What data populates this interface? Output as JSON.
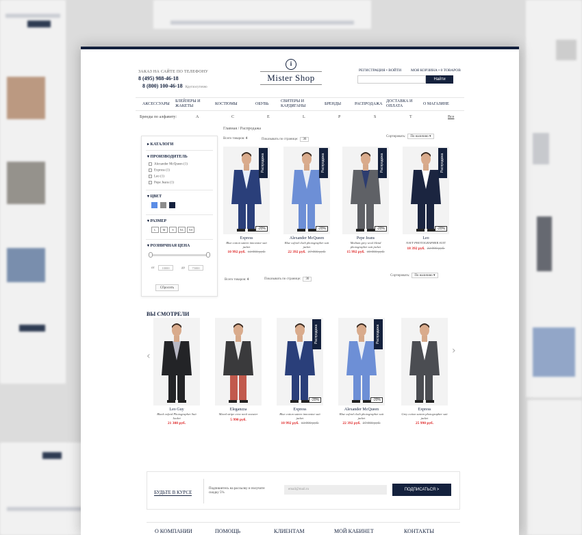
{
  "header": {
    "phone_caption": "Заказ на сайте по телефону",
    "phones": [
      "8 (495) 988-46-18",
      "8 (800) 100-46-18"
    ],
    "phone_note": "Круглосуточно",
    "logo_text": "Mister Shop",
    "logo_emblem": "i",
    "auth_link": "Регистрация • Войти",
    "cart_link": "Моя корзина • 0 товаров",
    "search_placeholder": "",
    "search_button": "Найти"
  },
  "nav": [
    {
      "label": "Аксессуары"
    },
    {
      "label": "Блейзеры и жакеты"
    },
    {
      "label": "Костюмы"
    },
    {
      "label": "Обувь"
    },
    {
      "label": "Свитеры и кардиганы"
    },
    {
      "label": "Бренды"
    },
    {
      "label": "Распродажа"
    },
    {
      "label": "Доставка и оплата"
    },
    {
      "label": "О магазине"
    }
  ],
  "brands_row": {
    "label": "Бренды по алфавиту:",
    "letters": [
      "A",
      "C",
      "E",
      "L",
      "P",
      "S",
      "T"
    ],
    "all": "Все"
  },
  "breadcrumb": "Главная / Распродажа",
  "sidebar": {
    "catalog": "Каталоги",
    "manufacturer": "Производитель",
    "manufacturers": [
      "Alexander McQueen (1)",
      "Express (1)",
      "Leo (1)",
      "Pepe Jeans (1)"
    ],
    "color": "Цвет",
    "colors": [
      "#5b8de6",
      "#8d8d8d",
      "#14213d"
    ],
    "size": "Размер",
    "sizes": [
      "L",
      "M",
      "S",
      "XL",
      "XS"
    ],
    "price": "Розничная цена",
    "price_from_label": "от",
    "price_from": "10000",
    "price_to_label": "до",
    "price_to": "75000",
    "reset": "Сбросить"
  },
  "toolbar": {
    "total_label": "Всего товаров:",
    "total": "4",
    "per_page_label": "Показывать по странице:",
    "per_page": "36",
    "sort_label": "Сортировать:",
    "sort_value": "По наличию"
  },
  "products": [
    {
      "name": "Express",
      "desc": "Blue cotton sateen innovator suit jacket",
      "price": "10 992 руб.",
      "old": "13 990 руб.",
      "discount": "-20%",
      "sale": "Распродажа",
      "jacket": "#2a3f7a",
      "shirt": "#e8eef8",
      "pants": "#2a3f7a"
    },
    {
      "name": "Alexander McQueen",
      "desc": "Blue oxford cloth photographer suit jacket",
      "price": "22 392 руб.",
      "old": "27 990 руб.",
      "discount": "-20%",
      "sale": "Распродажа",
      "jacket": "#6d8fd6",
      "shirt": "#e9edf5",
      "pants": "#6d8fd6"
    },
    {
      "name": "Pepe Jeans",
      "desc": "Medium grey wool blend photographer suit jacket",
      "price": "15 992 руб.",
      "old": "19 990 руб.",
      "discount": "-20%",
      "sale": "Распродажа",
      "jacket": "#5f6166",
      "shirt": "#2d3d6f",
      "pants": "#5f6166"
    },
    {
      "name": "Leo",
      "desc": "NAVY PHOTOGRAPHER SUIT",
      "price": "18 392 руб.",
      "old": "22 990 руб.",
      "discount": "-20%",
      "sale": "Распродажа",
      "jacket": "#1b2540",
      "shirt": "#ffffff",
      "pants": "#1b2540"
    }
  ],
  "viewed": {
    "title": "Вы смотрели",
    "items": [
      {
        "name": "Leo Guy",
        "desc": "Black oxford Photographer Suit Jacket",
        "price": "21 308 руб.",
        "old": "",
        "discount": "",
        "sale": "",
        "jacket": "#232427",
        "shirt": "#b8b8c4",
        "pants": "#232427"
      },
      {
        "name": "Eleganzza",
        "desc": "Mixed stripe crew neck sweater",
        "price": "5 990 руб.",
        "old": "",
        "discount": "",
        "sale": "",
        "jacket": "#3a3a3c",
        "shirt": "#e9e9e9",
        "pants": "#c15a4d"
      },
      {
        "name": "Express",
        "desc": "Blue cotton sateen innovator suit jacket",
        "price": "10 992 руб.",
        "old": "13 990 руб.",
        "discount": "-20%",
        "sale": "Распродажа",
        "jacket": "#2a3f7a",
        "shirt": "#e8eef8",
        "pants": "#2a3f7a"
      },
      {
        "name": "Alexander McQueen",
        "desc": "Blue oxford cloth photographer suit jacket",
        "price": "22 392 руб.",
        "old": "27 990 руб.",
        "discount": "-20%",
        "sale": "Распродажа",
        "jacket": "#6d8fd6",
        "shirt": "#e9edf5",
        "pants": "#6d8fd6"
      },
      {
        "name": "Express",
        "desc": "Grey cotton sateen photographer suit jacket",
        "price": "25 990 руб.",
        "old": "",
        "discount": "",
        "sale": "",
        "jacket": "#4b4d52",
        "shirt": "#ffffff",
        "pants": "#4b4d52"
      }
    ]
  },
  "newsletter": {
    "title": "Будьте в курсе",
    "text": "Подпишитесь на рассылку и получите скидку 5%",
    "placeholder": "email@mail.ru",
    "button": "Подписаться >"
  },
  "footer": [
    "О компании",
    "Помощь",
    "Клиентам",
    "Мой кабинет",
    "Контакты"
  ]
}
